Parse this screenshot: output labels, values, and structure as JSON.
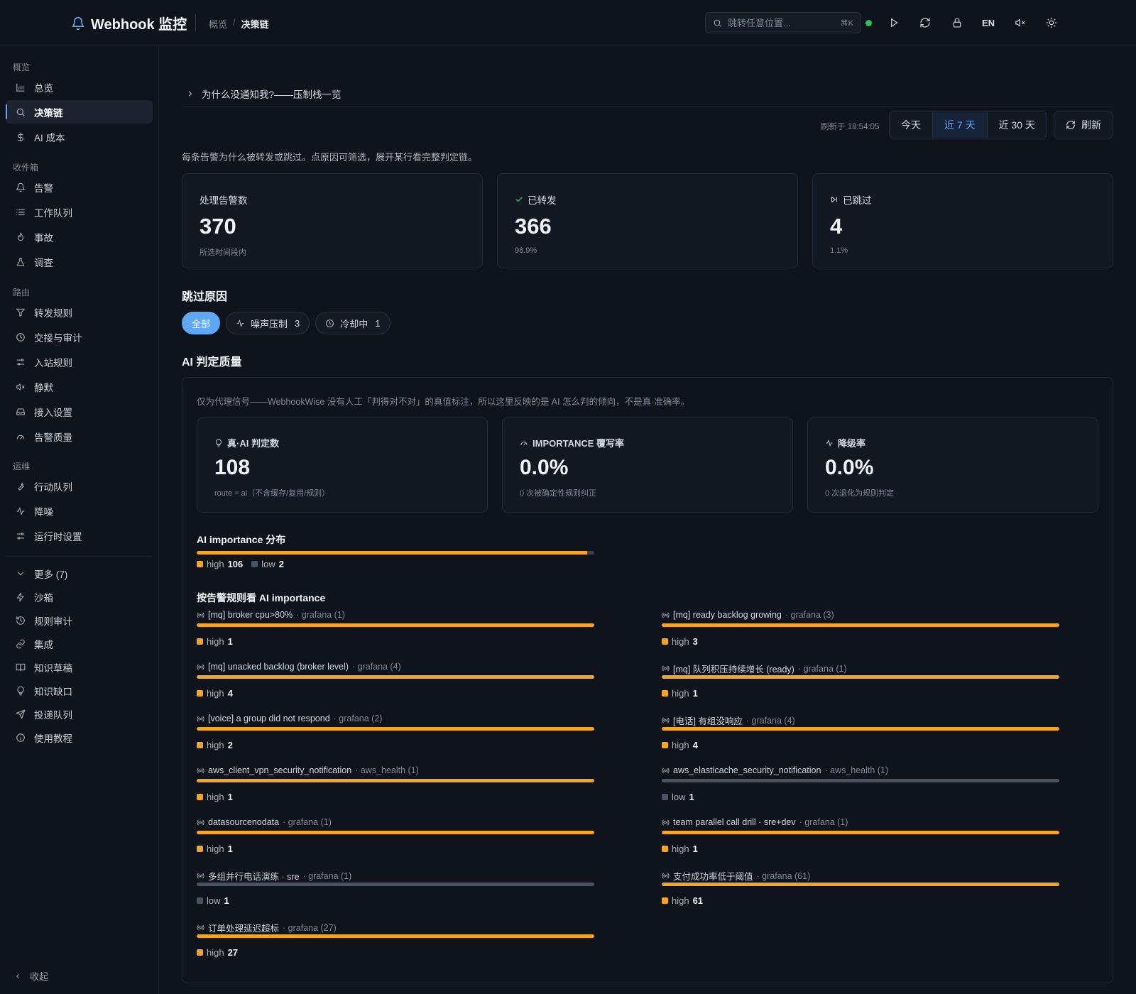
{
  "app": {
    "title": "Webhook 监控"
  },
  "breadcrumb": {
    "parent": "概览",
    "separator": "/",
    "current": "决策链"
  },
  "search": {
    "placeholder": "跳转任意位置...",
    "shortcut": "⌘K"
  },
  "topbar": {
    "lang": "EN"
  },
  "colors": {
    "accent": "#5fa8f5",
    "high": "#f4a623",
    "low": "#4a5363",
    "ok": "#30c25a"
  },
  "sidebar": {
    "sections": [
      {
        "label": "概览",
        "items": [
          {
            "label": "总览",
            "icon": "bar-chart-icon"
          },
          {
            "label": "决策链",
            "icon": "search-icon",
            "active": true
          },
          {
            "label": "AI 成本",
            "icon": "dollar-icon"
          }
        ]
      },
      {
        "label": "收件箱",
        "items": [
          {
            "label": "告警",
            "icon": "bell-icon"
          },
          {
            "label": "工作队列",
            "icon": "list-icon"
          },
          {
            "label": "事故",
            "icon": "flame-icon"
          },
          {
            "label": "调查",
            "icon": "flask-icon"
          }
        ]
      },
      {
        "label": "路由",
        "items": [
          {
            "label": "转发规则",
            "icon": "filter-icon"
          },
          {
            "label": "交接与审计",
            "icon": "clock-icon"
          },
          {
            "label": "入站规则",
            "icon": "sliders-icon"
          },
          {
            "label": "静默",
            "icon": "mute-icon"
          },
          {
            "label": "接入设置",
            "icon": "inbox-icon"
          },
          {
            "label": "告警质量",
            "icon": "gauge-icon"
          }
        ]
      },
      {
        "label": "运维",
        "items": [
          {
            "label": "行动队列",
            "icon": "wrench-icon"
          },
          {
            "label": "降噪",
            "icon": "activity-icon"
          },
          {
            "label": "运行时设置",
            "icon": "sliders-icon"
          }
        ]
      }
    ],
    "more": {
      "label": "更多 (7)",
      "items": [
        {
          "label": "沙箱",
          "icon": "zap-icon"
        },
        {
          "label": "规则审计",
          "icon": "history-icon"
        },
        {
          "label": "集成",
          "icon": "link-icon"
        },
        {
          "label": "知识草稿",
          "icon": "book-icon"
        },
        {
          "label": "知识缺口",
          "icon": "lightbulb-icon"
        },
        {
          "label": "投递队列",
          "icon": "send-icon"
        },
        {
          "label": "使用教程",
          "icon": "info-icon"
        }
      ]
    },
    "collapse_label": "收起"
  },
  "main": {
    "why_label": "为什么没通知我?——压制栈一览",
    "refresh_time": "刷新于 18:54:05",
    "ranges": [
      {
        "label": "今天"
      },
      {
        "label": "近 7 天",
        "active": true
      },
      {
        "label": "近 30 天"
      }
    ],
    "refresh_label": "刷新",
    "description": "每条告警为什么被转发或跳过。点原因可筛选，展开某行看完整判定链。",
    "stats": [
      {
        "label": "处理告警数",
        "value": "370",
        "sub": "所选时间段内",
        "icon": ""
      },
      {
        "label": "已转发",
        "value": "366",
        "sub": "98.9%",
        "icon": "check-icon"
      },
      {
        "label": "已跳过",
        "value": "4",
        "sub": "1.1%",
        "icon": "skip-icon"
      }
    ],
    "skip_heading": "跳过原因",
    "skip_chips": [
      {
        "label": "全部",
        "count": "",
        "active": true
      },
      {
        "label": "噪声压制",
        "count": "3",
        "icon": "activity-icon"
      },
      {
        "label": "冷却中",
        "count": "1",
        "icon": "clock-icon"
      }
    ],
    "ai_heading": "AI 判定质量",
    "ai": {
      "note": "仅为代理信号——WebhookWise 没有人工「判得对不对」的真值标注，所以这里反映的是 AI 怎么判的倾向，不是真·准确率。",
      "cards": [
        {
          "label": "真·AI 判定数",
          "value": "108",
          "sub": "route = ai（不含缓存/复用/规则）",
          "icon": "lightbulb-icon"
        },
        {
          "label": "IMPORTANCE 覆写率",
          "value": "0.0%",
          "sub": "0 次被确定性规则纠正",
          "icon": "gauge-icon"
        },
        {
          "label": "降级率",
          "value": "0.0%",
          "sub": "0 次退化为规则判定",
          "icon": "activity-icon"
        }
      ],
      "distribution_title": "AI importance 分布",
      "distribution": {
        "high": 106,
        "low": 2
      },
      "high_label": "high",
      "low_label": "low",
      "by_rule_title": "按告警规则看 AI importance"
    }
  },
  "chart_data": {
    "type": "bar",
    "title": "按告警规则看 AI importance",
    "series": [
      {
        "name": "high"
      },
      {
        "name": "low"
      }
    ],
    "rules": [
      {
        "name": "[mq] broker cpu>80%",
        "source": "· grafana (1)",
        "level": "high",
        "count": 1
      },
      {
        "name": "[mq] ready backlog growing",
        "source": "· grafana (3)",
        "level": "high",
        "count": 3
      },
      {
        "name": "[mq] unacked backlog (broker level)",
        "source": "· grafana (4)",
        "level": "high",
        "count": 4
      },
      {
        "name": "[mq] 队列积压持续增长 (ready)",
        "source": "· grafana (1)",
        "level": "high",
        "count": 1
      },
      {
        "name": "[voice] a group did not respond",
        "source": "· grafana (2)",
        "level": "high",
        "count": 2
      },
      {
        "name": "[电话] 有组没响应",
        "source": "· grafana (4)",
        "level": "high",
        "count": 4
      },
      {
        "name": "aws_client_vpn_security_notification",
        "source": "· aws_health (1)",
        "level": "high",
        "count": 1
      },
      {
        "name": "aws_elasticache_security_notification",
        "source": "· aws_health (1)",
        "level": "low",
        "count": 1
      },
      {
        "name": "datasourcenodata",
        "source": "· grafana (1)",
        "level": "high",
        "count": 1
      },
      {
        "name": "team parallel call drill · sre+dev",
        "source": "· grafana (1)",
        "level": "high",
        "count": 1
      },
      {
        "name": "多组并行电话演练 · sre",
        "source": "· grafana (1)",
        "level": "low",
        "count": 1
      },
      {
        "name": "支付成功率低于阈值",
        "source": "· grafana (61)",
        "level": "high",
        "count": 61
      },
      {
        "name": "订单处理延迟超标",
        "source": "· grafana (27)",
        "level": "high",
        "count": 27
      }
    ]
  }
}
